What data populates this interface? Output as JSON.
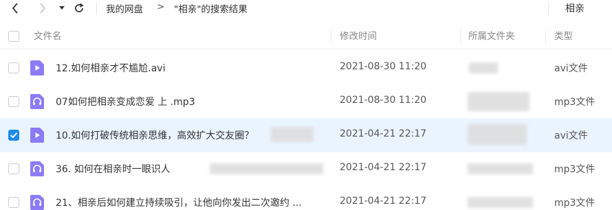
{
  "toolbar": {
    "back_icon": "chevron-left-icon",
    "forward_icon": "chevron-right-icon",
    "dropdown_icon": "caret-down-icon",
    "refresh_icon": "refresh-icon",
    "breadcrumb_root": "我的网盘",
    "breadcrumb_separator": ">",
    "breadcrumb_current": "\"相亲\"的搜索结果",
    "search_value": "相亲"
  },
  "header": {
    "name": "文件名",
    "modified": "修改时间",
    "folder": "所属文件夹",
    "type": "类型"
  },
  "files": [
    {
      "name": "12.如何相亲才不尴尬.avi",
      "modified": "2021-08-30 11:20",
      "type": "avi文件",
      "kind": "video",
      "selected": false
    },
    {
      "name": "07如何把相亲变成恋爱 上   .mp3",
      "modified": "2021-08-30 11:20",
      "type": "mp3文件",
      "kind": "audio",
      "selected": false
    },
    {
      "name": "10.如何打破传统相亲思维，高效扩大交友圈？",
      "modified": "2021-04-21 22:17",
      "type": "avi文件",
      "kind": "video",
      "selected": true
    },
    {
      "name": "36. 如何在相亲时一眼识人",
      "modified": "2021-04-21 22:17",
      "type": "mp3文件",
      "kind": "audio",
      "selected": false
    },
    {
      "name": "21、相亲后如何建立持续吸引，让他向你发出二次邀约   ...",
      "modified": "2021-04-21 22:17",
      "type": "mp3文件",
      "kind": "audio",
      "selected": false
    }
  ],
  "colors": {
    "accent": "#1f8ce6",
    "selected_row": "#eaf4fe",
    "file_icon": "#8b7cf6"
  }
}
